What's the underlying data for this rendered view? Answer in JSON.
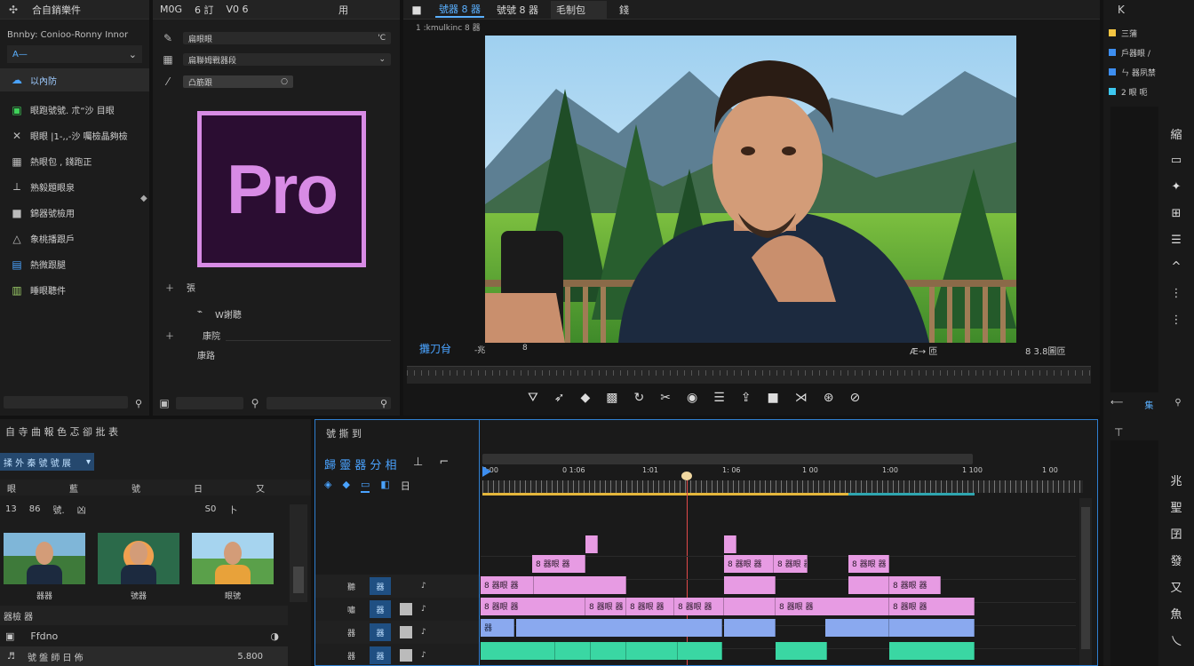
{
  "left_panel": {
    "title": "合自銷樂件",
    "subtitle": "Bnnby: Conioo-Ronny Innor",
    "dropdown": "A—",
    "selected_item": "以內防",
    "items": [
      {
        "icon": "cube-icon",
        "label": "眼跑號號. 朮“沙 目眼"
      },
      {
        "icon": "cross-icon",
        "label": "眼眼 |1-,,-沙 囑檢晶夠檢"
      },
      {
        "icon": "grid-icon",
        "label": "熱眼包 , 錢跑正"
      },
      {
        "icon": "pen-icon",
        "label": "熟毅題眼泉"
      },
      {
        "icon": "square-icon",
        "label": "錦器號檢用"
      },
      {
        "icon": "triangle-icon",
        "label": "象桃播跟戶"
      },
      {
        "icon": "screen-icon",
        "label": "熱微跟腿"
      },
      {
        "icon": "chart-icon",
        "label": "睡眼聽件"
      }
    ],
    "search_placeholder": ""
  },
  "effects_panel": {
    "tabs": [
      "M0G",
      "6 訂",
      "V0 6"
    ],
    "right_tab": "用",
    "rows": [
      {
        "label": "扁眼眼",
        "suffix": "'C"
      },
      {
        "label": "扁聯姆戰器段"
      },
      {
        "label": "凸筋跟"
      }
    ],
    "logo_text": "Pro",
    "extra_rows": [
      "張",
      "W謝聽",
      "康院",
      "康路"
    ]
  },
  "program_monitor": {
    "tabs": [
      "號器 8 器",
      "號號 8 器",
      "毛制包",
      "錢"
    ],
    "subtitle": "1 :kmulkinc 8 器",
    "timecode_left": "攤刀䏌",
    "timecode_mid": "-兆",
    "timecode_mid2": "8",
    "timecode_right": "Æ→ 匝",
    "timecode_far": "8 3.8圖匝",
    "transport": [
      "marker-icon",
      "arrow-icon",
      "shape-icon",
      "grid-icon",
      "loop-icon",
      "cut-icon",
      "circle-icon",
      "list-icon",
      "export-icon",
      "square-icon",
      "trim-icon",
      "globe-icon",
      "lines-icon"
    ]
  },
  "right_strip": {
    "top_arrow": "K",
    "items": [
      {
        "label": "三蒲",
        "color": "#f4c542"
      },
      {
        "label": "戶器眼 /",
        "color": "#3d8ef0"
      },
      {
        "label": "ㄣ 器夙禁",
        "color": "#3d8ef0"
      },
      {
        "label": "2 眼 呃",
        "color": "#3dc8f0"
      }
    ],
    "bottom_label": "集",
    "tools": [
      "縮",
      "▭",
      "✦",
      "⊞",
      "☰",
      "^",
      "⋮",
      "⋮"
    ],
    "timeline_tools": [
      "兆",
      "聖",
      "囝",
      "發",
      "又",
      "魚",
      "乀"
    ]
  },
  "project_panel": {
    "title": "自 寺 曲 報 色 忑 卻 批 表",
    "search": "揉 外 秦 號 號 展",
    "columns": [
      "眼",
      "藍",
      "號",
      "日",
      "又"
    ],
    "toolbar": [
      "13",
      "86",
      "號.",
      "凶",
      "S0",
      "卜"
    ],
    "thumbnails": [
      {
        "label": "器器",
        "kind": "man"
      },
      {
        "label": "號器",
        "kind": "woman"
      },
      {
        "label": "眼號",
        "kind": "cartoon"
      }
    ],
    "section": "器檢 器",
    "list_item": "Ffdno",
    "bottom_item": "號 盤 師 日 佈",
    "bottom_value": "5.800"
  },
  "timeline": {
    "title": "號 撕 到",
    "sequence_label": "歸 靈 器 分 相",
    "ruler_labels": [
      "0:00",
      "0 1:06",
      "1:01",
      "1: 06",
      "1 00",
      "1:00",
      "1 100",
      "1 00"
    ],
    "track_labels": [
      "聽",
      "嘯",
      "器",
      "器"
    ],
    "track_buttons": [
      "器",
      "器",
      "器",
      "器"
    ],
    "clips_label_pink": "8 器眼 器",
    "clips_label_blue": "器"
  }
}
